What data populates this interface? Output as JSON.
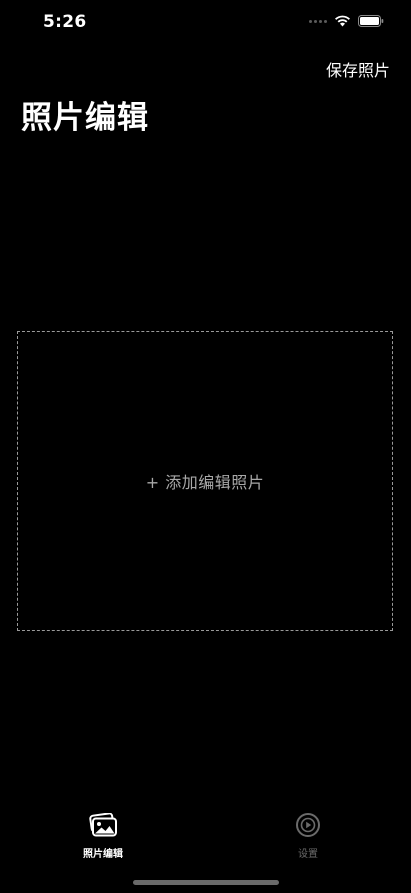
{
  "status_bar": {
    "time": "5:26"
  },
  "header": {
    "save_label": "保存照片",
    "title": "照片编辑"
  },
  "drop_zone": {
    "label": "+ 添加编辑照片"
  },
  "tab_bar": {
    "tabs": [
      {
        "label": "照片编辑",
        "icon": "photo-stack-icon",
        "active": true
      },
      {
        "label": "设置",
        "icon": "play-circle-icon",
        "active": false
      }
    ]
  },
  "colors": {
    "background": "#000000",
    "text": "#ffffff",
    "muted": "#a8a8a8",
    "inactive_tab": "#6b6b6b",
    "dashed_border": "#9a9a9a"
  }
}
